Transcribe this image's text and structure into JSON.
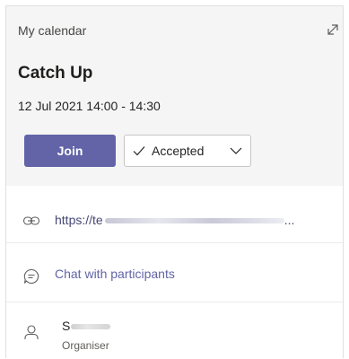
{
  "header": {
    "source": "My calendar",
    "title": "Catch Up",
    "datetime": "12 Jul 2021 14:00 - 14:30",
    "join_label": "Join",
    "rsvp_label": "Accepted"
  },
  "details": {
    "meeting_link": "https://te",
    "meeting_link_suffix": "...",
    "chat_label": "Chat with participants",
    "organiser_name": "S",
    "organiser_role": "Organiser"
  },
  "colors": {
    "accent": "#6264a7",
    "header_bg": "#f5f5f5"
  },
  "icons": [
    "expand-icon",
    "checkmark-icon",
    "chevron-down-icon",
    "link-icon",
    "chat-icon",
    "person-icon"
  ]
}
